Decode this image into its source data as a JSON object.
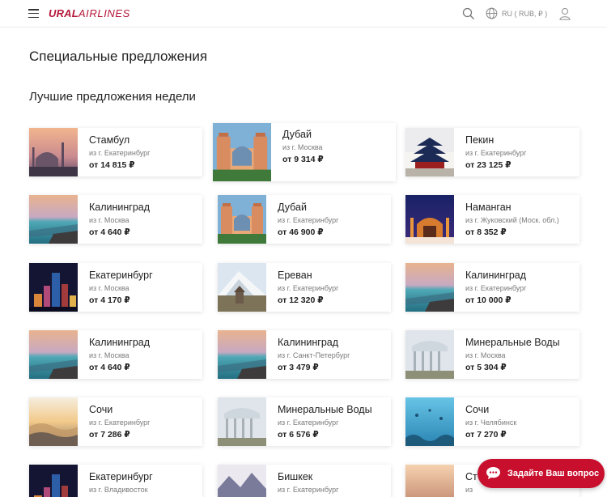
{
  "header": {
    "logo_ural": "URAL",
    "logo_airlines": "AIRLINES",
    "lang_label": "RU ( RUB, ₽ )"
  },
  "page_title": "Специальные предложения",
  "section_title": "Лучшие предложения недели",
  "offers": [
    {
      "city": "Стамбул",
      "from": "из г. Екатеринбург",
      "price": "от 14 815 ₽",
      "image": "istanbul-mosque-sunset"
    },
    {
      "city": "Дубай",
      "from": "из г. Москва",
      "price": "от 9 314 ₽",
      "image": "dubai-atlantis-hotel"
    },
    {
      "city": "Пекин",
      "from": "из г. Екатеринбург",
      "price": "от 23 125 ₽",
      "image": "beijing-temple-of-heaven"
    },
    {
      "city": "Калининград",
      "from": "из г. Москва",
      "price": "от 4 640 ₽",
      "image": "kaliningrad-sea-sunset"
    },
    {
      "city": "Дубай",
      "from": "из г. Екатеринбург",
      "price": "от 46 900 ₽",
      "image": "dubai-atlantis-hotel"
    },
    {
      "city": "Наманган",
      "from": "из г. Жуковский (Моск. обл.)",
      "price": "от 8 352 ₽",
      "image": "namangan-night-madrasa"
    },
    {
      "city": "Екатеринбург",
      "from": "из г. Москва",
      "price": "от 4 170 ₽",
      "image": "yekaterinburg-night-city"
    },
    {
      "city": "Ереван",
      "from": "из г. Екатеринбург",
      "price": "от 12 320 ₽",
      "image": "yerevan-ararat-mountain"
    },
    {
      "city": "Калининград",
      "from": "из г. Екатеринбург",
      "price": "от 10 000 ₽",
      "image": "kaliningrad-sea-sunset"
    },
    {
      "city": "Калининград",
      "from": "из г. Москва",
      "price": "от 4 640 ₽",
      "image": "kaliningrad-sea-sunset"
    },
    {
      "city": "Калининград",
      "from": "из г. Санкт-Петербург",
      "price": "от 3 479 ₽",
      "image": "kaliningrad-sea-sunset"
    },
    {
      "city": "Минеральные Воды",
      "from": "из г. Москва",
      "price": "от 5 304 ₽",
      "image": "mineralnye-vody-colonnade"
    },
    {
      "city": "Сочи",
      "from": "из г. Екатеринбург",
      "price": "от 7 286 ₽",
      "image": "sochi-sea-waves"
    },
    {
      "city": "Минеральные Воды",
      "from": "из г. Екатеринбург",
      "price": "от 6 576 ₽",
      "image": "mineralnye-vody-colonnade"
    },
    {
      "city": "Сочи",
      "from": "из г. Челябинск",
      "price": "от 7 270 ₽",
      "image": "sochi-underwater"
    },
    {
      "city": "Екатеринбург",
      "from": "из г. Владивосток",
      "price": "",
      "image": "yekaterinburg-night-city"
    },
    {
      "city": "Бишкек",
      "from": "из г. Екатеринбург",
      "price": "",
      "image": "bishkek-mountains"
    },
    {
      "city": "Ст",
      "from": "из",
      "price": "",
      "image": "stavropol-sunset"
    }
  ],
  "ask_button": {
    "label": "Задайте Ваш вопрос"
  },
  "colors": {
    "brand": "#c8102e",
    "logo": "#b5173a"
  }
}
